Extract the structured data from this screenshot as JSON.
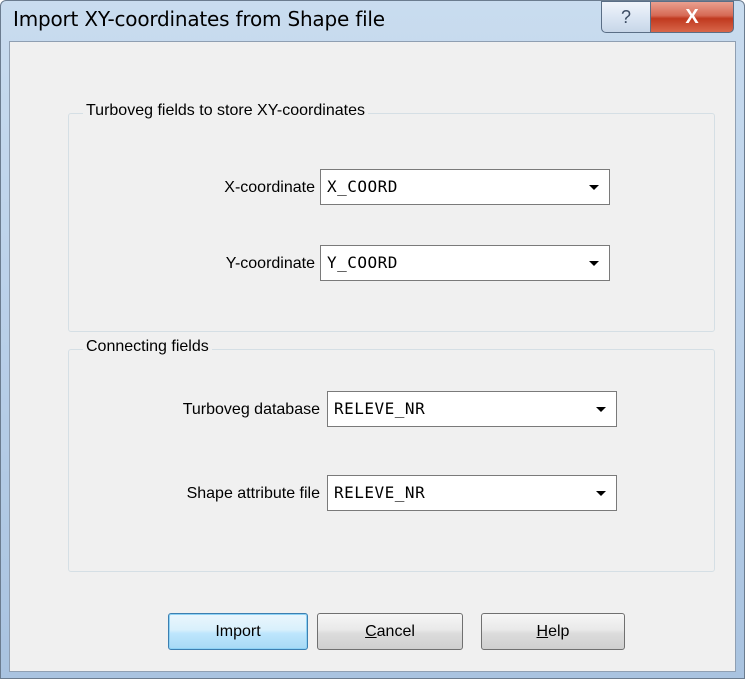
{
  "window": {
    "title": "Import XY-coordinates from Shape file",
    "help_glyph": "?",
    "close_glyph": "X"
  },
  "group_xy": {
    "legend": "Turboveg fields to store XY-coordinates",
    "x_label": "X-coordinate",
    "x_value": "X_COORD",
    "y_label": "Y-coordinate",
    "y_value": "Y_COORD"
  },
  "group_connect": {
    "legend": "Connecting fields",
    "db_label": "Turboveg database",
    "db_value": "RELEVE_NR",
    "shape_label": "Shape attribute file",
    "shape_value": "RELEVE_NR"
  },
  "buttons": {
    "import": "Import",
    "cancel_mnemonic": "C",
    "cancel_rest": "ancel",
    "help_mnemonic": "H",
    "help_rest": "elp"
  },
  "icons": {
    "dropdown": "chevron-down-icon",
    "help": "question-icon",
    "close": "close-icon"
  }
}
